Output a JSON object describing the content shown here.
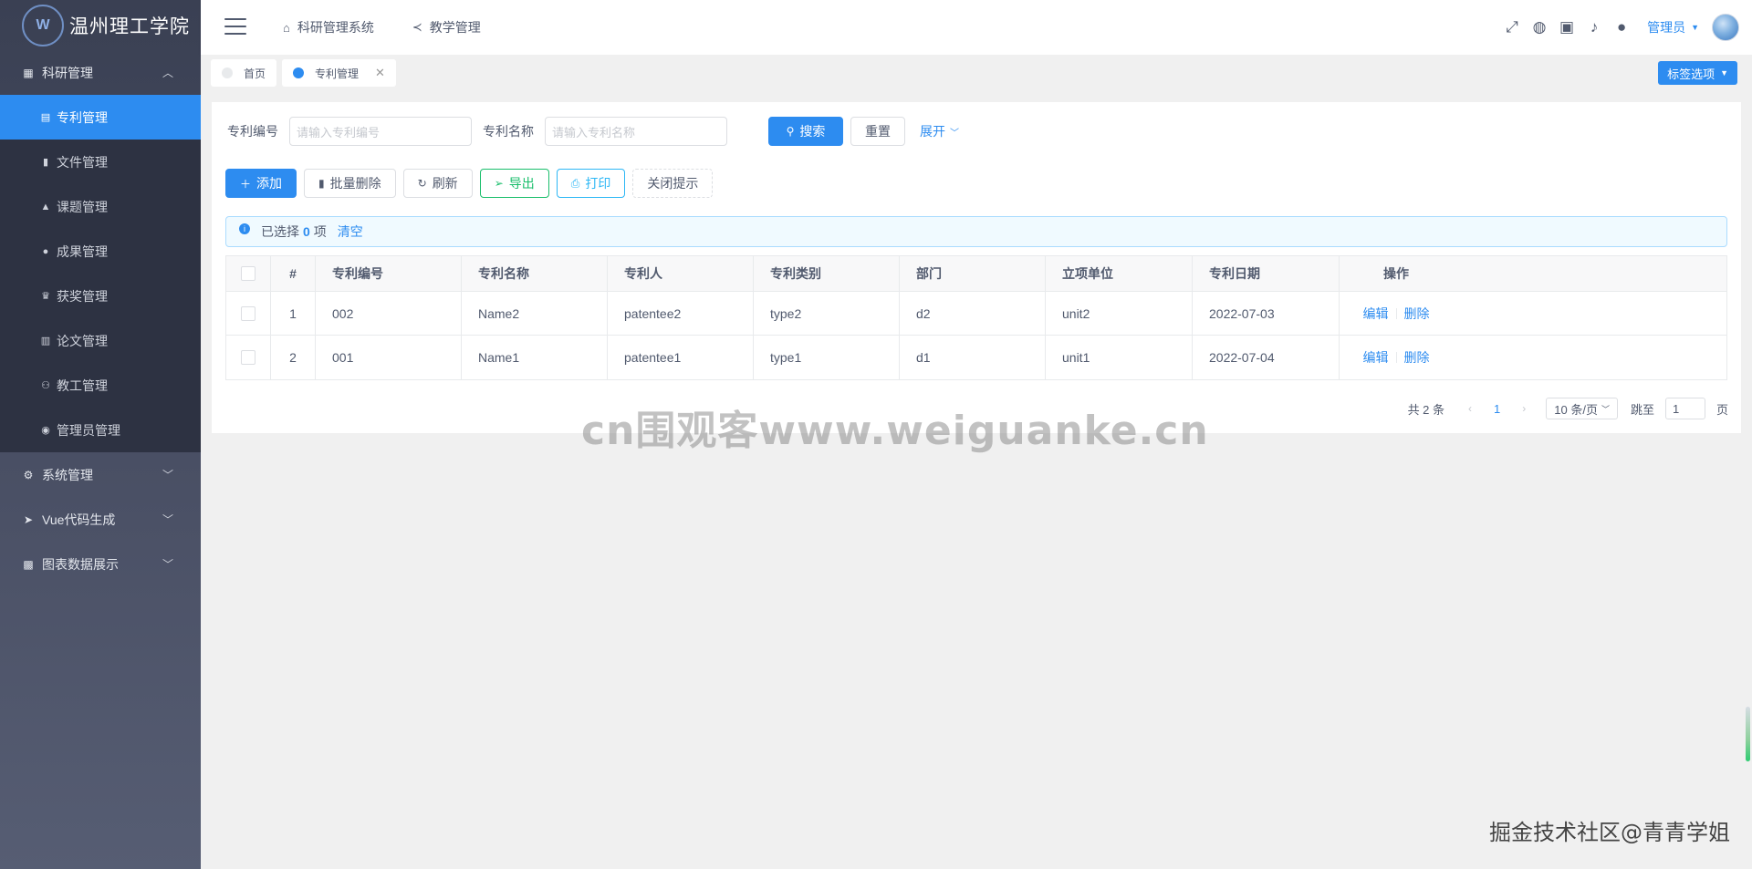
{
  "sidebar": {
    "logo_emblem": "W",
    "logo_text": "温州理工学院",
    "groups": [
      {
        "label": "科研管理",
        "icon": "grid-icon",
        "expanded": true
      },
      {
        "label": "系统管理",
        "icon": "gear-icon",
        "expanded": false
      },
      {
        "label": "Vue代码生成",
        "icon": "send-icon",
        "expanded": false
      },
      {
        "label": "图表数据展示",
        "icon": "chart-icon",
        "expanded": false
      }
    ],
    "items": [
      {
        "label": "专利管理",
        "icon": "document-icon",
        "active": true
      },
      {
        "label": "文件管理",
        "icon": "file-icon"
      },
      {
        "label": "课题管理",
        "icon": "flask-icon"
      },
      {
        "label": "成果管理",
        "icon": "circle-icon"
      },
      {
        "label": "获奖管理",
        "icon": "trophy-icon"
      },
      {
        "label": "论文管理",
        "icon": "book-icon"
      },
      {
        "label": "教工管理",
        "icon": "people-icon"
      },
      {
        "label": "管理员管理",
        "icon": "user-circle-icon"
      }
    ]
  },
  "header": {
    "nav": [
      {
        "label": "科研管理系统",
        "icon": "home-icon"
      },
      {
        "label": "教学管理",
        "icon": "share-icon"
      }
    ],
    "user_label": "管理员"
  },
  "tabs": {
    "items": [
      {
        "label": "首页",
        "active": false
      },
      {
        "label": "专利管理",
        "active": true
      }
    ],
    "options_label": "标签选项"
  },
  "search": {
    "number_label": "专利编号",
    "number_placeholder": "请输入专利编号",
    "name_label": "专利名称",
    "name_placeholder": "请输入专利名称",
    "search_button": "搜索",
    "reset_button": "重置",
    "expand_label": "展开"
  },
  "actions": {
    "add": "添加",
    "batch_delete": "批量删除",
    "refresh": "刷新",
    "export": "导出",
    "print": "打印",
    "close_tip": "关闭提示"
  },
  "alert": {
    "prefix": "已选择",
    "count": "0",
    "suffix": "项",
    "clear": "清空"
  },
  "table": {
    "columns": [
      "#",
      "专利编号",
      "专利名称",
      "专利人",
      "专利类别",
      "部门",
      "立项单位",
      "专利日期",
      "操作"
    ],
    "rows": [
      {
        "index": "1",
        "number": "002",
        "name": "Name2",
        "patentee": "patentee2",
        "type": "type2",
        "dept": "d2",
        "unit": "unit2",
        "date": "2022-07-03"
      },
      {
        "index": "2",
        "number": "001",
        "name": "Name1",
        "patentee": "patentee1",
        "type": "type1",
        "dept": "d1",
        "unit": "unit1",
        "date": "2022-07-04"
      }
    ],
    "edit_label": "编辑",
    "delete_label": "删除"
  },
  "pager": {
    "total": "共 2 条",
    "current": "1",
    "page_size": "10 条/页",
    "jump_label": "跳至",
    "jump_value": "1",
    "page_suffix": "页"
  },
  "watermark": "cn围观客www.weiguanke.cn",
  "footer_mark": "掘金技术社区@青青学姐"
}
